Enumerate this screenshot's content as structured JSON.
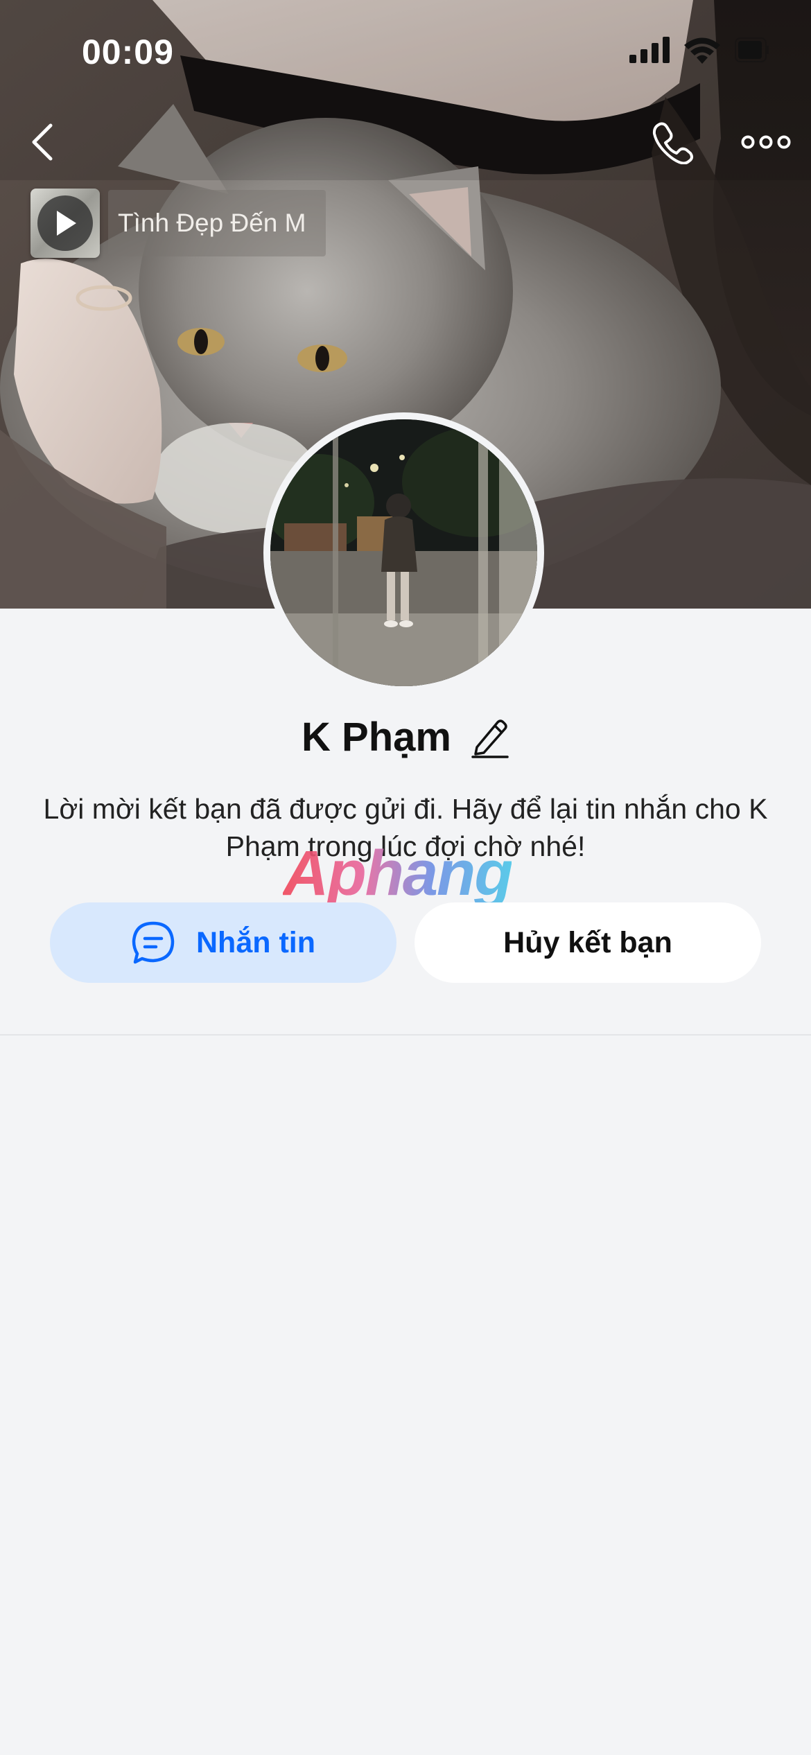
{
  "status_bar": {
    "time": "00:09",
    "icons": [
      "signal-icon",
      "wifi-icon",
      "battery-icon"
    ]
  },
  "nav": {
    "back_icon": "chevron-left-icon",
    "call_icon": "phone-icon",
    "more_icon": "more-icon"
  },
  "music": {
    "title": "Tình Đẹp Đến M",
    "play_icon": "play-icon"
  },
  "profile": {
    "name": "K Phạm",
    "edit_icon": "pencil-icon",
    "description": "Lời mời kết bạn đã được gửi đi. Hãy để lại tin nhắn cho K Phạm trong lúc đợi chờ nhé!"
  },
  "watermark": "Aphang",
  "actions": {
    "message_label": "Nhắn tin",
    "message_icon": "chat-icon",
    "unfriend_label": "Hủy kết bạn"
  },
  "colors": {
    "accent": "#0a68ff",
    "message_button_bg": "#d8e8fd",
    "page_bg": "#f3f4f6"
  }
}
